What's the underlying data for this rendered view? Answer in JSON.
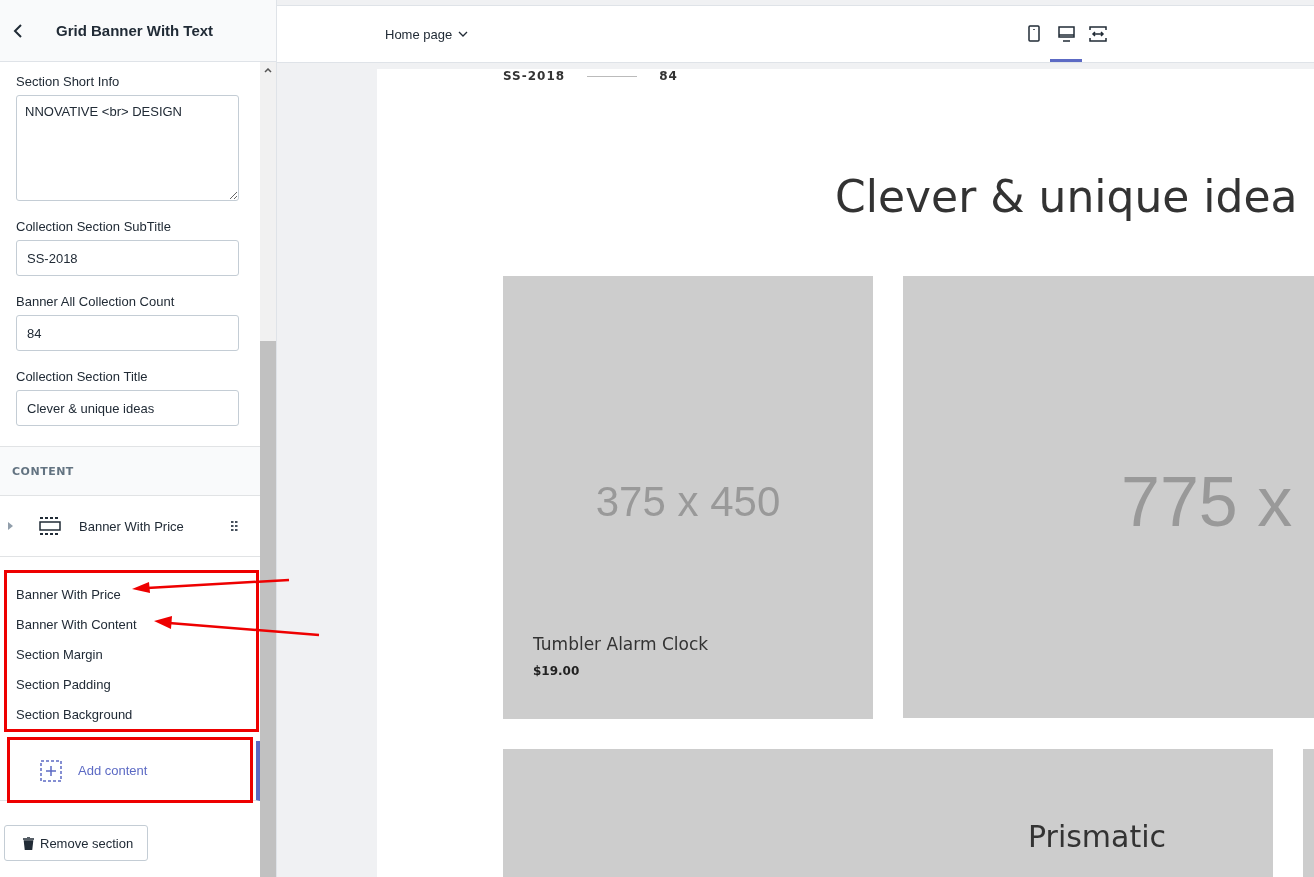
{
  "panel": {
    "title": "Grid Banner With Text",
    "fields": [
      {
        "kind": "textarea",
        "label": "Section Short Info",
        "value": "NNOVATIVE <br> DESIGN"
      },
      {
        "kind": "text",
        "label": "Collection Section SubTitle",
        "value": "SS-2018"
      },
      {
        "kind": "text",
        "label": "Banner All Collection Count",
        "value": "84"
      },
      {
        "kind": "text",
        "label": "Collection Section Title",
        "value": "Clever & unique ideas"
      }
    ],
    "content_heading": "CONTENT",
    "blocks": [
      {
        "label": "Banner With Price"
      }
    ],
    "options": [
      {
        "label": "Banner With Price",
        "annotated": true
      },
      {
        "label": "Banner With Content",
        "annotated": true
      },
      {
        "label": "Section Margin",
        "annotated": false
      },
      {
        "label": "Section Padding",
        "annotated": false
      },
      {
        "label": "Section Background",
        "annotated": false
      }
    ],
    "add_content": "Add content",
    "remove_button": "Remove section"
  },
  "toolbar": {
    "page_select": "Home page",
    "views": [
      {
        "kind": "mobile",
        "selected": false
      },
      {
        "kind": "desktop",
        "selected": true
      },
      {
        "kind": "fullscreen",
        "selected": false
      }
    ]
  },
  "preview": {
    "subtitle": "SS-2018",
    "count": "84",
    "title": "Clever & unique idea",
    "cards": [
      {
        "placeholder": "375 x 450",
        "name": "Tumbler Alarm Clock",
        "price": "$19.00"
      },
      {
        "placeholder": "775 x"
      }
    ],
    "second_row": [
      {
        "text": "Prismatic"
      }
    ]
  }
}
